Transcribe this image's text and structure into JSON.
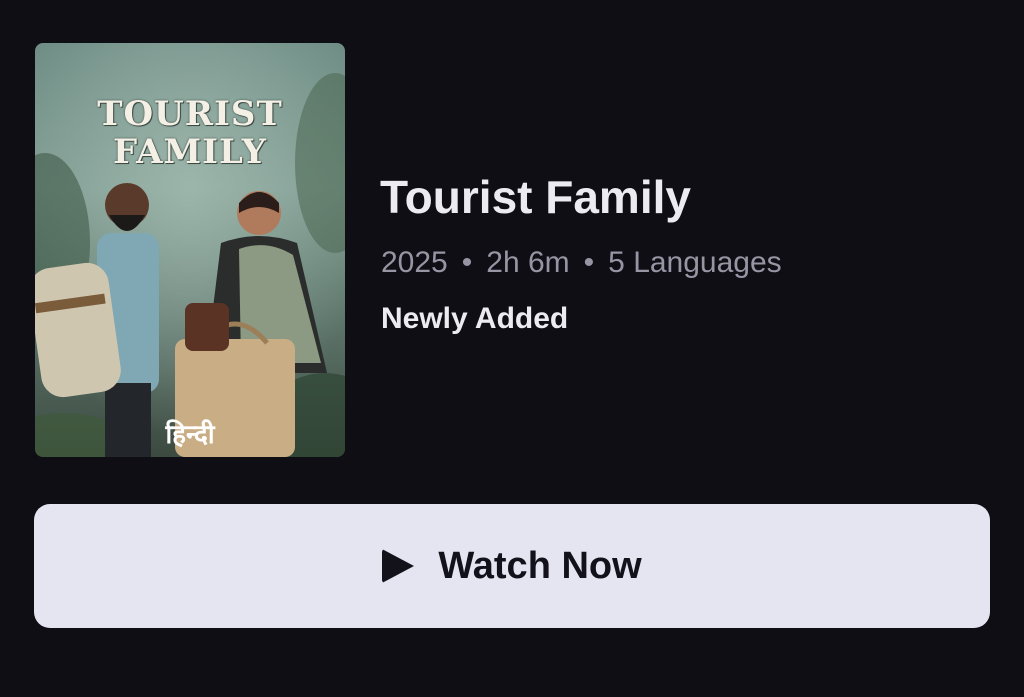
{
  "poster": {
    "title_line1": "TOURIST",
    "title_line2": "FAMILY",
    "language_label": "हिन्दी"
  },
  "movie": {
    "title": "Tourist Family",
    "year": "2025",
    "duration": "2h 6m",
    "languages": "5 Languages",
    "separator": "•",
    "tag": "Newly Added"
  },
  "actions": {
    "watch_now_label": "Watch Now",
    "watch_now_icon": "play-icon"
  },
  "colors": {
    "background": "#0f0e15",
    "button_bg": "#e5e5f2",
    "title_text": "#ecebf1",
    "meta_text": "#9795a3"
  }
}
